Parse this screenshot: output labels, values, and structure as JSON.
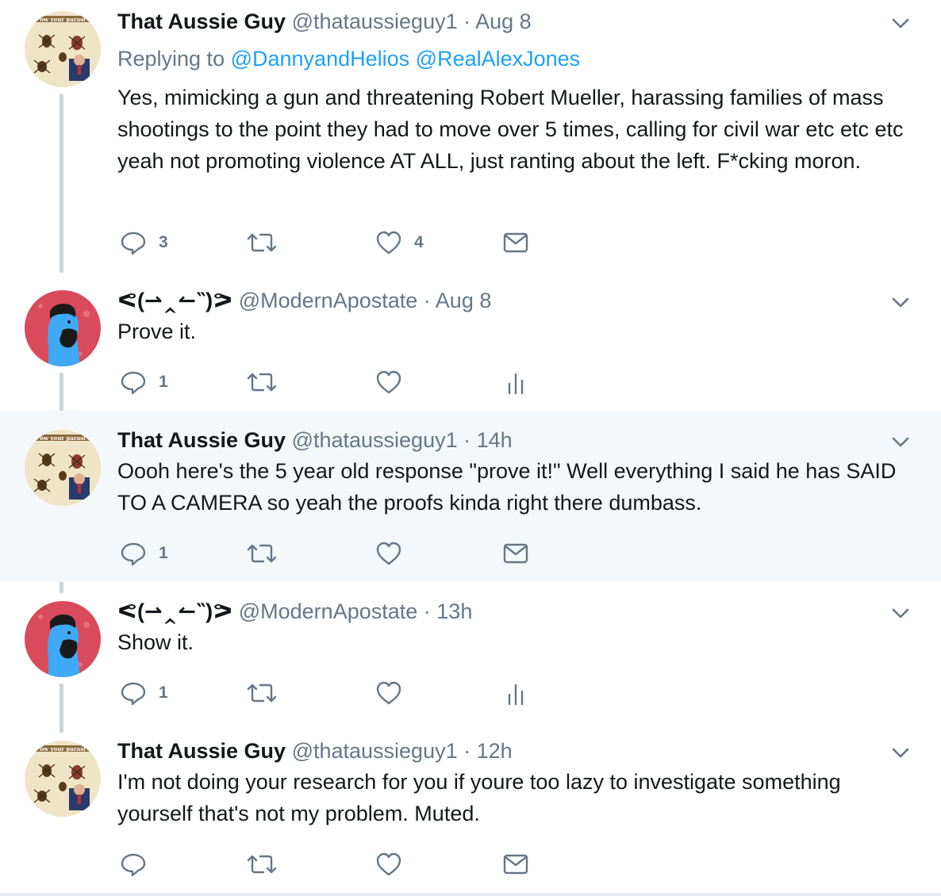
{
  "tweets": [
    {
      "author_name": "That Aussie Guy",
      "handle": "@thataussieguy1",
      "separator": " · ",
      "time": "Aug 8",
      "replying_label": "Replying to ",
      "replying_to": [
        "@DannyandHelios",
        "@RealAlexJones"
      ],
      "text": "Yes, mimicking a gun and threatening Robert Mueller, harassing families of mass shootings to the point they had to move over 5 times, calling for civil war etc etc etc yeah not promoting violence AT ALL, just ranting about the left. F*cking moron.",
      "reply_count": "3",
      "retweet_count": "",
      "like_count": "4",
      "last_action_icon": "envelope-icon",
      "avatar_icon": "spider-collage-avatar"
    },
    {
      "author_name": "ᕙ(⇀‸↼‶)ᕗ",
      "handle": "@ModernApostate",
      "separator": " · ",
      "time": "Aug 8",
      "text": "Prove it.",
      "reply_count": "1",
      "retweet_count": "",
      "like_count": "",
      "last_action_icon": "analytics-icon",
      "avatar_icon": "bearded-man-avatar"
    },
    {
      "author_name": "That Aussie Guy",
      "handle": "@thataussieguy1",
      "separator": " · ",
      "time": "14h",
      "text": "Oooh here's the 5 year old response \"prove it!\" Well everything I said he has SAID TO A CAMERA so yeah the proofs kinda right there dumbass.",
      "reply_count": "1",
      "retweet_count": "",
      "like_count": "",
      "last_action_icon": "envelope-icon",
      "avatar_icon": "spider-collage-avatar"
    },
    {
      "author_name": "ᕙ(⇀‸↼‶)ᕗ",
      "handle": "@ModernApostate",
      "separator": " · ",
      "time": "13h",
      "text": "Show it.",
      "reply_count": "1",
      "retweet_count": "",
      "like_count": "",
      "last_action_icon": "analytics-icon",
      "avatar_icon": "bearded-man-avatar"
    },
    {
      "author_name": "That Aussie Guy",
      "handle": "@thataussieguy1",
      "separator": " · ",
      "time": "12h",
      "text": "I'm not doing your research for you if youre too lazy to investigate something yourself that's not my problem. Muted.",
      "reply_count": "",
      "retweet_count": "",
      "like_count": "",
      "last_action_icon": "envelope-icon",
      "avatar_icon": "spider-collage-avatar"
    }
  ],
  "colors": {
    "text": "#14171a",
    "secondary": "#657786",
    "link": "#1da1f2",
    "highlight_bg": "#f5f8fa",
    "thread_line": "#ccd6dd",
    "icon": "#657786",
    "avatar_red": "#d94a5c",
    "avatar_blue": "#3fa9f5"
  }
}
